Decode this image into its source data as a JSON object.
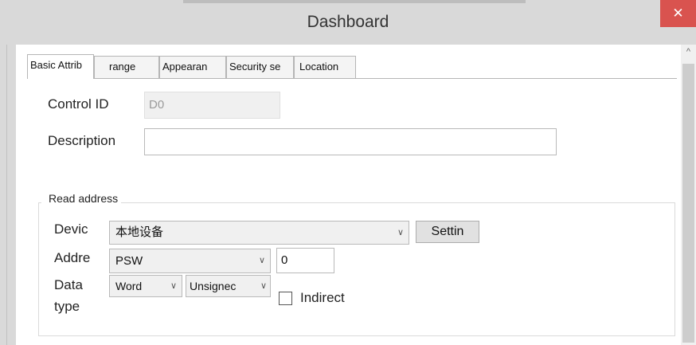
{
  "window": {
    "title": "Dashboard",
    "close_glyph": "✕"
  },
  "scrollbar": {
    "up_glyph": "^"
  },
  "tabs": [
    {
      "label": "Basic Attrib",
      "active": true
    },
    {
      "label": "range",
      "active": false
    },
    {
      "label": "Appearan",
      "active": false
    },
    {
      "label": "Security se",
      "active": false
    },
    {
      "label": "Location",
      "active": false
    }
  ],
  "basic": {
    "control_id_label": "Control ID",
    "control_id_value": "D0",
    "description_label": "Description",
    "description_value": ""
  },
  "read_address": {
    "group_title": "Read address",
    "device_label": "Devic",
    "device_value": "本地设备",
    "settings_button": "Settin",
    "address_label": "Addre",
    "address_type_value": "PSW",
    "address_value": "0",
    "data_type_label_line1": "Data",
    "data_type_label_line2": "type",
    "data_type_value": "Word",
    "sign_value": "Unsignec",
    "indirect_label": "Indirect",
    "indirect_checked": false,
    "dropdown_glyph": "∨"
  }
}
